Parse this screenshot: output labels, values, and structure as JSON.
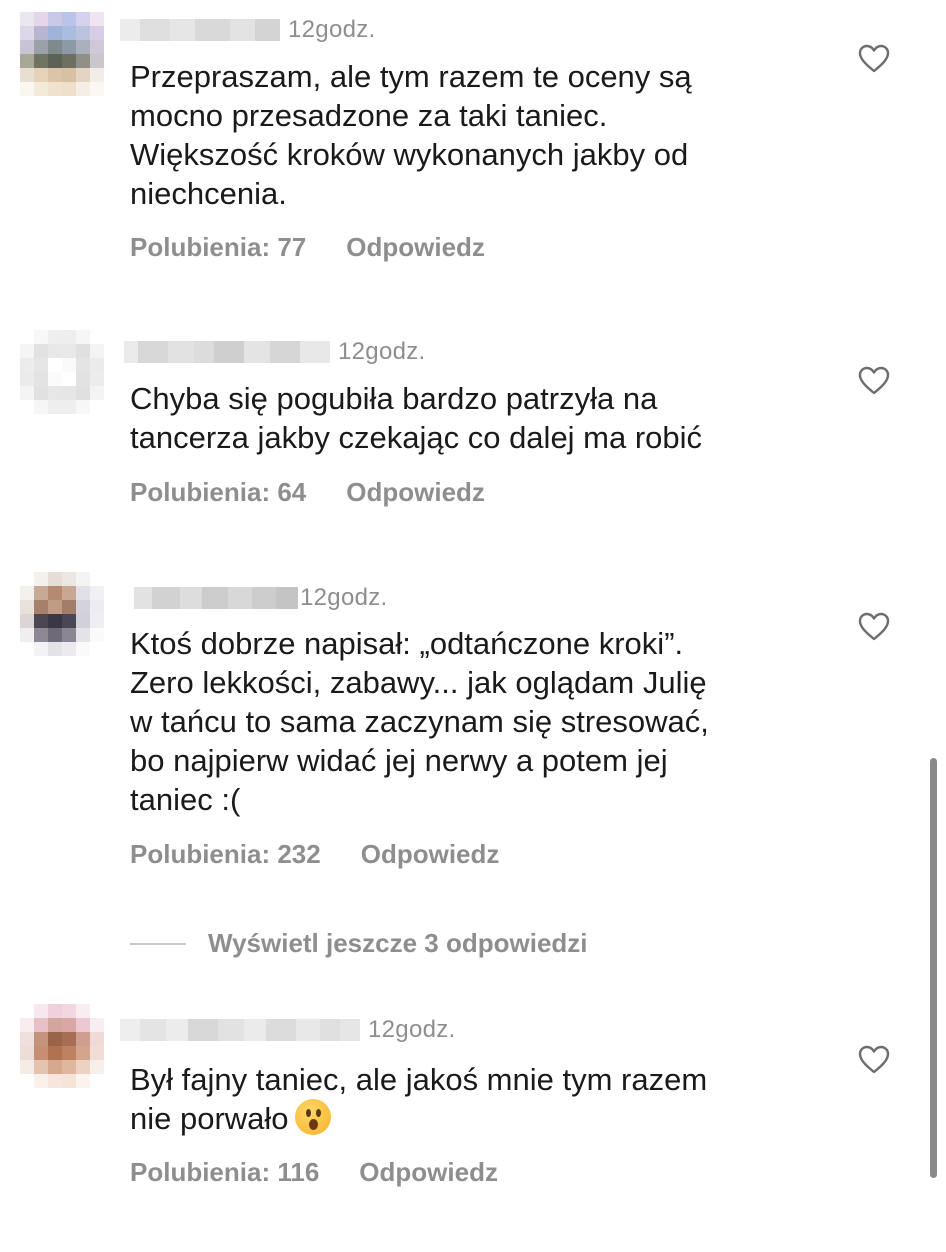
{
  "comments": [
    {
      "time": "12godz.",
      "lines": [
        "Przepraszam, ale tym razem te oceny są",
        "mocno przesadzone za taki taniec.",
        "Większość kroków wykonanych jakby od",
        "niechcenia."
      ],
      "likes": "Polubienia: 77",
      "reply": "Odpowiedz"
    },
    {
      "time": "12godz.",
      "lines": [
        "Chyba się pogubiła bardzo patrzyła na",
        "tancerza jakby czekając co dalej ma robić"
      ],
      "likes": "Polubienia: 64",
      "reply": "Odpowiedz"
    },
    {
      "time": "12godz.",
      "lines": [
        "Ktoś dobrze napisał: „odtańczone kroki”.",
        "Zero lekkości, zabawy... jak oglądam Julię",
        "w tańcu to sama zaczynam się stresować,",
        "bo najpierw widać jej nerwy a potem jej",
        "taniec :("
      ],
      "likes": "Polubienia: 232",
      "reply": "Odpowiedz"
    },
    {
      "time": "12godz.",
      "lines": [
        "Był fajny taniec, ale jakoś mnie tym razem",
        "nie porwało"
      ],
      "likes": "Polubienia: 116",
      "reply": "Odpowiedz",
      "emoji": "hushed-face-emoji"
    }
  ],
  "view_more_replies": "Wyświetl jeszcze 3 odpowiedzi",
  "icons": {
    "like": "heart-outline-icon"
  },
  "colors": {
    "secondary_text": "#8e8e8e",
    "primary_text": "#1a1a1a"
  }
}
